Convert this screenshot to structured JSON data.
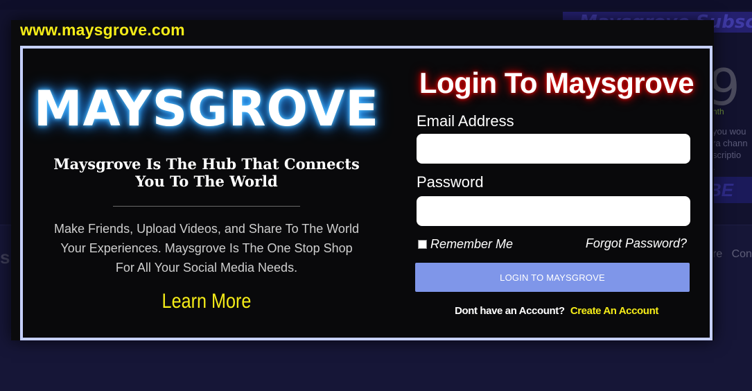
{
  "modal": {
    "site_url": "www.maysgrove.com",
    "brand": "MAYSGROVE",
    "tagline": "Maysgrove Is The Hub That Connects You To The World",
    "intro": "Make Friends, Upload Videos, and Share To The World\nYour Experiences.  Maysgrove Is The One Stop Shop\nFor All Your Social Media Needs.",
    "learn_more": "Learn More",
    "login": {
      "title": "Login To Maysgrove",
      "email_label": "Email Address",
      "email_value": "",
      "password_label": "Password",
      "password_value": "",
      "remember_label": "Remember Me",
      "remember_checked": false,
      "forgot_label": "Forgot Password?",
      "button_label": "LOGIN TO MAYSGROVE",
      "signup_prompt": "Dont have an Account?",
      "signup_link": "Create An Account"
    }
  },
  "background": {
    "subscription_banner": "Maysgrove Subscripti",
    "price_digit": "9",
    "price_period": "nth",
    "description_lines": [
      "you wou",
      "ra chann",
      "scriptio",
      "."
    ],
    "subscribe_button": "BE",
    "left_heading": "s P",
    "nav_items": [
      "re",
      "Con"
    ]
  },
  "colors": {
    "accent_yellow": "#f5ec18",
    "modal_border": "#c6d0ff",
    "button_blue": "#7f96e9",
    "page_background": "#161637"
  }
}
